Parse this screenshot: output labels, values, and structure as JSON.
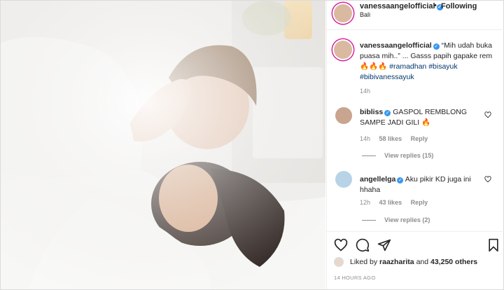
{
  "post": {
    "account": "vanessaangelofficial",
    "follow_separator": "•",
    "follow_label": "Following",
    "location": "Bali",
    "caption_text": "“Mih udah buka puasa mih..” ... Gasss papih gapake rem 🔥🔥🔥",
    "hashtags": [
      "#ramadhan",
      "#bisayuk",
      "#bibivanessayuk"
    ],
    "caption_time": "14h",
    "likes_prefix": "Liked by",
    "liked_by_user": "raazharita",
    "likes_conjunction": "and",
    "likes_others": "43,250 others",
    "post_time": "14 HOURS AGO"
  },
  "comments": [
    {
      "user": "bibliss",
      "text": "GASPOL REMBLONG SAMPE JADI GILI 🔥",
      "time": "14h",
      "likes": "58 likes",
      "reply_label": "Reply",
      "view_replies": "View replies (15)"
    },
    {
      "user": "angellelga",
      "text": "Aku pikir KD juga ini hhaha",
      "time": "12h",
      "likes": "43 likes",
      "reply_label": "Reply",
      "view_replies": "View replies (2)"
    }
  ],
  "icons": {
    "like": "heart-outline-icon",
    "comment": "speech-bubble-icon",
    "share": "paper-plane-icon",
    "save": "bookmark-icon",
    "verified": "verified-badge-icon"
  },
  "colors": {
    "link": "#00376b",
    "verified": "#3897f0",
    "muted": "#8e8e8e",
    "border": "#dbdbdb"
  }
}
